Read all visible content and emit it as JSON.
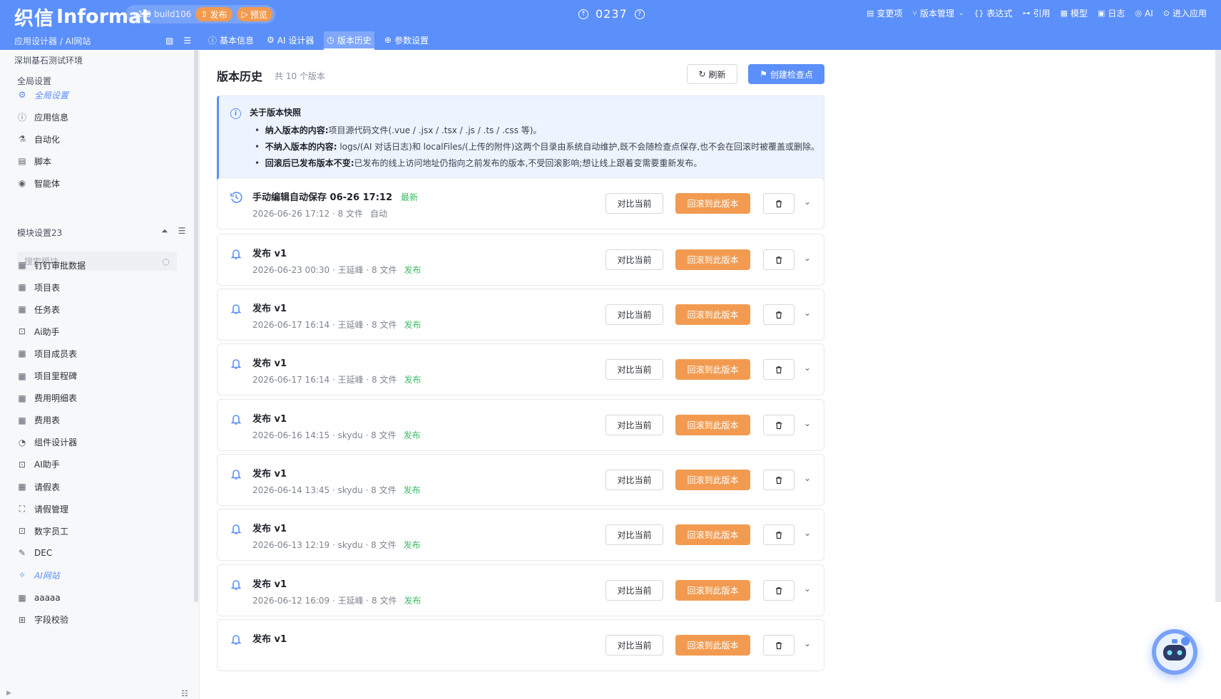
{
  "header": {
    "logo_mark": "织信",
    "logo_text": "Informat",
    "build": "v1.0 build106",
    "publish_label": "发布",
    "preview_label": "预览",
    "center_number": "0237",
    "menu": [
      {
        "icon": "file-icon",
        "glyph": "▤",
        "label": "变更项"
      },
      {
        "icon": "branch-icon",
        "glyph": "⑂",
        "label": "版本管理"
      },
      {
        "icon": "brace-icon",
        "glyph": "{}",
        "label": "表达式"
      },
      {
        "icon": "link-icon",
        "glyph": "⊶",
        "label": "引用"
      },
      {
        "icon": "grid-icon",
        "glyph": "▦",
        "label": "模型"
      },
      {
        "icon": "image-icon",
        "glyph": "▣",
        "label": "日志"
      },
      {
        "icon": "ai-icon",
        "glyph": "◎",
        "label": "AI"
      },
      {
        "icon": "enter-icon",
        "glyph": "⊙",
        "label": "进入应用"
      }
    ],
    "breadcrumb": "应用设计器 / AI网站",
    "tabs": [
      {
        "icon": "info-icon",
        "glyph": "ⓘ",
        "label": "基本信息"
      },
      {
        "icon": "ai-design-icon",
        "glyph": "⚙",
        "label": "AI 设计器"
      },
      {
        "icon": "history-icon",
        "glyph": "◷",
        "label": "版本历史"
      },
      {
        "icon": "globe-icon",
        "glyph": "⊕",
        "label": "参数设置"
      }
    ]
  },
  "sidebar": {
    "env": "深圳基石测试环境",
    "global_title": "全局设置",
    "global_items": [
      {
        "icon": "gear-icon",
        "glyph": "⚙",
        "label": "全局设置"
      },
      {
        "icon": "info-icon",
        "glyph": "ⓘ",
        "label": "应用信息"
      },
      {
        "icon": "flask-icon",
        "glyph": "⚗",
        "label": "自动化"
      },
      {
        "icon": "script-icon",
        "glyph": "▤",
        "label": "脚本"
      },
      {
        "icon": "agent-icon",
        "glyph": "◉",
        "label": "智能体"
      }
    ],
    "module_title": "模块设置23",
    "search_placeholder": "搜索模块",
    "modules": [
      {
        "icon": "table-icon",
        "glyph": "▦",
        "label": "钉钉审批数据"
      },
      {
        "icon": "table-icon",
        "glyph": "▦",
        "label": "项目表"
      },
      {
        "icon": "table-icon",
        "glyph": "▦",
        "label": "任务表"
      },
      {
        "icon": "robot-icon",
        "glyph": "⊡",
        "label": "Ai助手"
      },
      {
        "icon": "table-icon",
        "glyph": "▦",
        "label": "项目成员表"
      },
      {
        "icon": "table-icon",
        "glyph": "▦",
        "label": "项目里程碑"
      },
      {
        "icon": "table-icon",
        "glyph": "▦",
        "label": "费用明细表"
      },
      {
        "icon": "table-icon",
        "glyph": "▦",
        "label": "费用表"
      },
      {
        "icon": "palette-icon",
        "glyph": "◔",
        "label": "组件设计器"
      },
      {
        "icon": "robot-icon",
        "glyph": "⊡",
        "label": "AI助手"
      },
      {
        "icon": "table-icon",
        "glyph": "▦",
        "label": "请假表"
      },
      {
        "icon": "workflow-icon",
        "glyph": "⛶",
        "label": "请假管理"
      },
      {
        "icon": "robot-icon",
        "glyph": "⊡",
        "label": "数字员工"
      },
      {
        "icon": "edit-icon",
        "glyph": "✎",
        "label": "DEC"
      },
      {
        "icon": "ai-web-icon",
        "glyph": "✧",
        "label": "AI网站"
      },
      {
        "icon": "table-icon",
        "glyph": "▦",
        "label": "aaaaa"
      },
      {
        "icon": "folder-icon",
        "glyph": "⊞",
        "label": "字段校验"
      }
    ]
  },
  "main": {
    "title": "版本历史",
    "count": "共 10 个版本",
    "refresh_label": "刷新",
    "checkpoint_label": "创建检查点",
    "info": {
      "title": "关于版本快照",
      "lines": [
        {
          "label": "纳入版本的内容:",
          "text": "项目源代码文件(.vue / .jsx / .tsx / .js / .ts / .css 等)。"
        },
        {
          "label": "不纳入版本的内容:",
          "text": " logs/(AI 对话日志)和 localFiles/(上传的附件)这两个目录由系统自动维护,既不会随检查点保存,也不会在回滚时被覆盖或删除。"
        },
        {
          "label": "回滚后已发布版本不变:",
          "text": "已发布的线上访问地址仍指向之前发布的版本,不受回滚影响;想让线上跟着变需要重新发布。"
        }
      ]
    },
    "compare_label": "对比当前",
    "rollback_label": "回滚到此版本",
    "versions": [
      {
        "title": "手动编辑自动保存 06-26 17:12",
        "tag": "最新",
        "meta": "2026-06-26 17:12 · 8 文件",
        "kind": "自动"
      },
      {
        "title": "发布 v1",
        "tag": "",
        "meta": "2026-06-23 00:30 · 王延峰 · 8 文件",
        "kind": "发布"
      },
      {
        "title": "发布 v1",
        "tag": "",
        "meta": "2026-06-17 16:14 · 王延峰 · 8 文件",
        "kind": "发布"
      },
      {
        "title": "发布 v1",
        "tag": "",
        "meta": "2026-06-17 16:14 · 王延峰 · 8 文件",
        "kind": "发布"
      },
      {
        "title": "发布 v1",
        "tag": "",
        "meta": "2026-06-16 14:15 · skydu · 8 文件",
        "kind": "发布"
      },
      {
        "title": "发布 v1",
        "tag": "",
        "meta": "2026-06-14 13:45 · skydu · 8 文件",
        "kind": "发布"
      },
      {
        "title": "发布 v1",
        "tag": "",
        "meta": "2026-06-13 12:19 · skydu · 8 文件",
        "kind": "发布"
      },
      {
        "title": "发布 v1",
        "tag": "",
        "meta": "2026-06-12 16:09 · 王延峰 · 8 文件",
        "kind": "发布"
      },
      {
        "title": "发布 v1",
        "tag": "",
        "meta": "",
        "kind": ""
      }
    ]
  },
  "colors": {
    "brand": "#5b8ff9",
    "accent": "#f29b50",
    "tag_green": "#3dbb63"
  }
}
